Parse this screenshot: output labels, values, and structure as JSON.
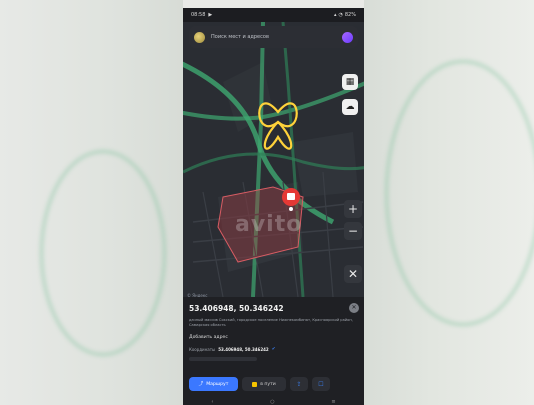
{
  "status_bar": {
    "time": "08:58",
    "left_icon": "play-icon",
    "battery": "82%"
  },
  "search": {
    "placeholder": "Поиск мест и адресов"
  },
  "map": {
    "watermark": "avito",
    "attribution": "© Яндекс"
  },
  "place_card": {
    "coordinates_title": "53.406948, 50.346242",
    "address_line": "дачный массив Сокский, городское поселение Нижнекомбинат, Красноярский район, Самарская область",
    "add_address_label": "Добавить адрес",
    "coordinates_label": "Координаты",
    "coordinates_value": "53.406948, 50.346242",
    "route_label": "Маршрут",
    "taxi_label": "в пути"
  },
  "colors": {
    "accent": "#3b78ff",
    "road": "#3fa870",
    "highlight": "#ffd23a",
    "pin": "#e53935"
  }
}
